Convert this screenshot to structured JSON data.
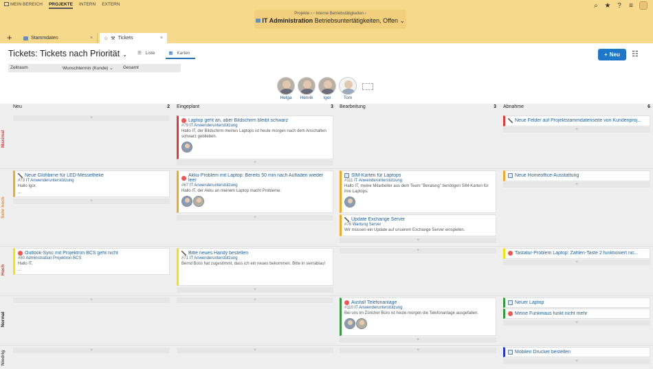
{
  "topnav": {
    "items": [
      {
        "label": "MEIN BEREICH"
      },
      {
        "label": "PROJEKTE"
      },
      {
        "label": "INTERN"
      },
      {
        "label": "EXTERN"
      }
    ]
  },
  "header": {
    "breadcrumb": "Projekte  ›  ▫ Interne Betriebstätigkeiten  ›",
    "context_title": "IT Administration",
    "context_sub": "Betriebsuntertätigkeiten, Offen"
  },
  "tabs": [
    {
      "label": "Stammdaten",
      "close": "×"
    },
    {
      "label": "Tickets",
      "close": "×"
    }
  ],
  "page": {
    "title": "Tickets: Tickets nach Priorität",
    "view_list": "Liste",
    "view_cards": "Karten",
    "new_button": "Neu"
  },
  "filters": {
    "f1": "Zeitraum",
    "f2": "Wunschtermin (Kunde)",
    "f3": "Gesamt"
  },
  "people": [
    "Helga",
    "Henrik",
    "Igor",
    "Tom"
  ],
  "columns": [
    {
      "name": "Neu",
      "count": "2"
    },
    {
      "name": "Eingeplant",
      "count": "3"
    },
    {
      "name": "Bearbeitung",
      "count": "3"
    },
    {
      "name": "Abnahme",
      "count": "6"
    }
  ],
  "lanes": [
    "Maximal",
    "Sehr hoch",
    "Hoch",
    "Normal",
    "Niedrig"
  ],
  "cards": {
    "c1": {
      "title": "Laptop geht an, aber Bildschirm bleibt schwarz",
      "id": "#79",
      "project": "IT Anwenderunterstützung",
      "body": "Hallo IT, der Bildschirm meines Laptops ist heute morgen nach dem Anschalten schwarz geblieben."
    },
    "c2": {
      "title": "Neue Felder auf Projektstammdatenseite von Kundenproj..."
    },
    "c3": {
      "title": "Neue Glühbirne für LED-Messetheke",
      "id": "#73",
      "project": "IT Anwenderunterstützung",
      "body": "Hallo Igor,",
      "body2": "..."
    },
    "c4": {
      "title": "Akku-Problem mit Laptop: Bereits 50 min nach Aufladen wieder leer",
      "id": "#67",
      "project": "IT Anwenderunterstützung",
      "body": "Hallo IT, der Akku an meinem Laptop macht Probleme."
    },
    "c5": {
      "title": "SIM-Karten für Laptops",
      "id": "#111",
      "project": "IT Anwenderunterstützung",
      "body": "Hallo IT, meine Mitarbeiter aus dem Team \"Beratung\" benötigen SIM-Karten für ihre Laptops."
    },
    "c6": {
      "title": "Update Exchange Server",
      "id": "#76",
      "project": "Wartung Server",
      "body": "Wir müssen ein Update auf unserem Exchange Server einspielen."
    },
    "c7": {
      "title": "Neue Homeoffice-Ausstattung"
    },
    "c8": {
      "title": "Outlook-Sync mit Projektron BCS geht nicht",
      "id": "#80",
      "project": "Administration Projektron BCS",
      "body": "Hallo IT,",
      "body2": "..."
    },
    "c9": {
      "title": "Bitte neues Handy bestellen",
      "id": "#71",
      "project": "IT Anwenderunterstützung",
      "body": "Bernd Boss hat zugestimmt, dass ich ein neues bekommen. Bitte in sierrablau!"
    },
    "c10": {
      "title": "Tastatur-Problem Laptop: Zahlen-Taste 2 funktioniert nic..."
    },
    "c11": {
      "title": "Ausfall Telefonanlage",
      "id": "#110",
      "project": "IT Anwenderunterstützung",
      "body": "Bei uns im Züricher Büro ist heute morgen die Telefonanlage ausgefallen."
    },
    "c12": {
      "title": "Neuer Laptop"
    },
    "c13": {
      "title": "Meine Funkmaus funkt nicht mehr"
    },
    "c14": {
      "title": "Mobilen Drucker bestellen"
    }
  },
  "colors": {
    "accent": "#1f77c9",
    "topbar": "#f7d98b",
    "maximal": "#e53935",
    "sehr_hoch": "#f5a623",
    "hoch": "#f2e600",
    "normal": "#2e9d3a",
    "niedrig": "#2433d6"
  }
}
